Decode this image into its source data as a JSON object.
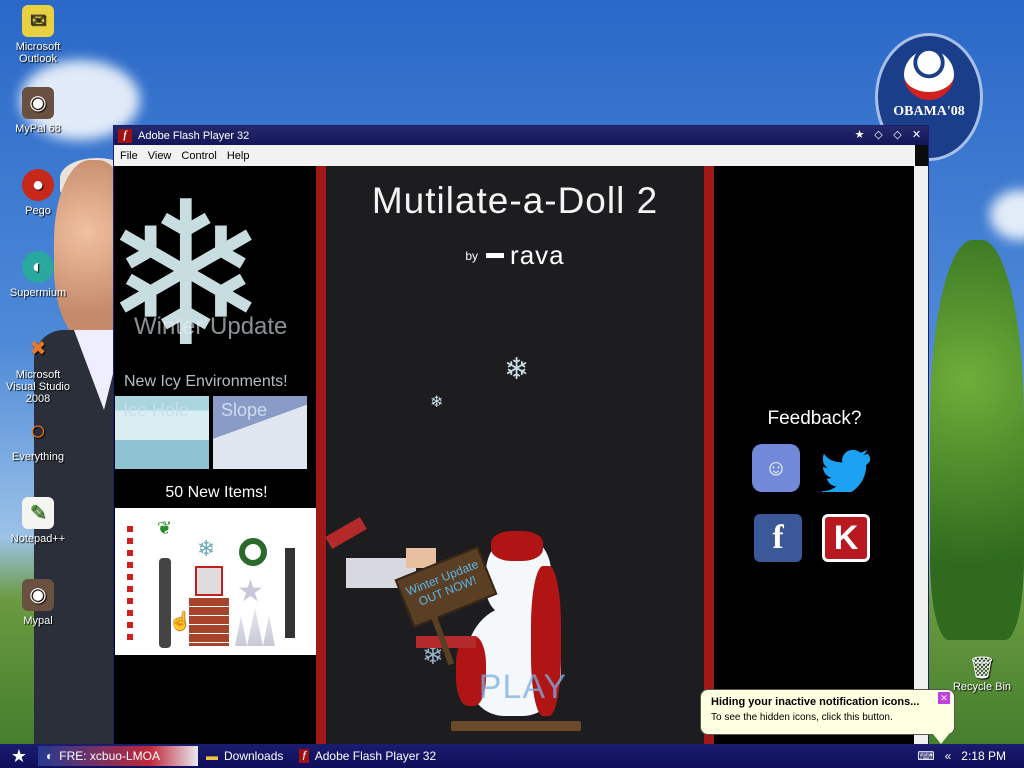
{
  "desktop": {
    "icons": [
      {
        "label": "Microsoft Outlook",
        "icon": "outlook-icon"
      },
      {
        "label": "MyPal 68",
        "icon": "mypal-icon"
      },
      {
        "label": "Pego",
        "icon": "pego-icon"
      },
      {
        "label": "Supermium",
        "icon": "supermium-icon"
      },
      {
        "label": "Microsoft Visual Studio 2008",
        "icon": "visual-studio-icon"
      },
      {
        "label": "Everything",
        "icon": "everything-icon"
      },
      {
        "label": "Notepad++",
        "icon": "notepadpp-icon"
      },
      {
        "label": "Mypal",
        "icon": "mypal-icon"
      }
    ],
    "recycle_bin": "Recycle Bin",
    "badge": {
      "text": "OBAMA'08"
    }
  },
  "window": {
    "title": "Adobe Flash Player 32",
    "menu": [
      "File",
      "View",
      "Control",
      "Help"
    ]
  },
  "game": {
    "left": {
      "winter_title": "Winter Update",
      "new_env": "New Icy Environments!",
      "env1": "Ice Hole",
      "env2": "Slope",
      "items_head": "50 New Items!"
    },
    "center": {
      "title": "Mutilate-a-Doll 2",
      "by": "by",
      "author": "rava",
      "sign": "Winter Update OUT NOW!",
      "play": "PLAY"
    },
    "right": {
      "feedback": "Feedback?",
      "links": [
        "discord-icon",
        "twitter-icon",
        "facebook-icon",
        "kongregate-icon"
      ]
    }
  },
  "taskbar": {
    "buttons": [
      "FRE: xcbuo-LMOA",
      "Downloads",
      "Adobe Flash Player 32"
    ],
    "clock": "2:18 PM"
  },
  "balloon": {
    "title": "Hiding your inactive notification icons...",
    "body": "To see the hidden icons, click this button."
  }
}
